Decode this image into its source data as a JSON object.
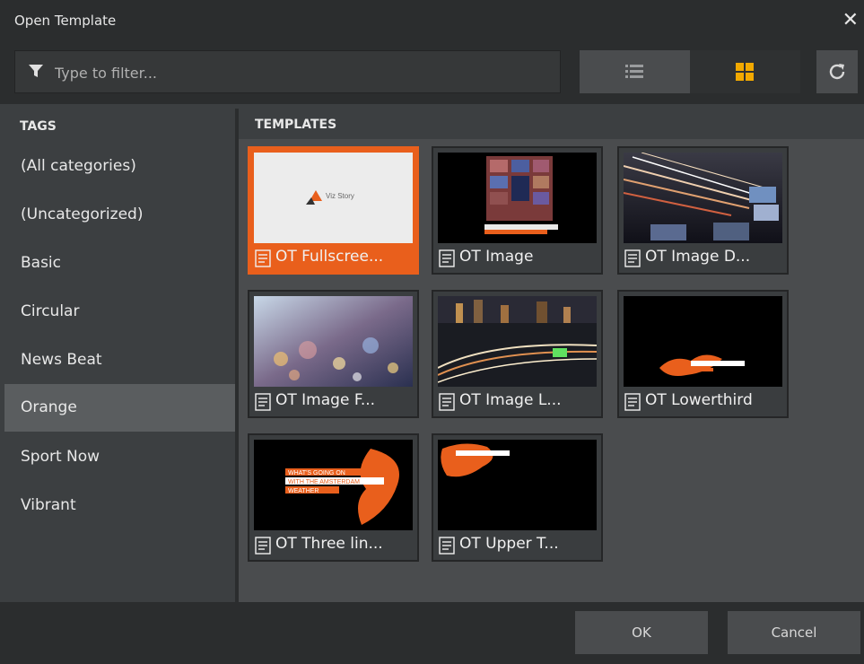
{
  "dialog": {
    "title": "Open Template",
    "close_icon": "close-icon"
  },
  "filter": {
    "placeholder": "Type to filter...",
    "icon": "filter-icon"
  },
  "view": {
    "list_icon": "list-view-icon",
    "grid_icon": "grid-view-icon",
    "selected": "grid",
    "accent_color": "#f2a900"
  },
  "refresh": {
    "icon": "refresh-icon"
  },
  "tags": {
    "header": "TAGS",
    "items": [
      {
        "label": "(All categories)"
      },
      {
        "label": "(Uncategorized)"
      },
      {
        "label": "Basic"
      },
      {
        "label": "Circular"
      },
      {
        "label": "News Beat"
      },
      {
        "label": "Orange",
        "selected": true
      },
      {
        "label": "Sport Now"
      },
      {
        "label": "Vibrant"
      }
    ]
  },
  "templates": {
    "header": "TEMPLATES",
    "items": [
      {
        "label": "OT Fullscree...",
        "selected": true,
        "thumb_text": "Viz Story"
      },
      {
        "label": "OT Image"
      },
      {
        "label": "OT Image D..."
      },
      {
        "label": "OT Image F..."
      },
      {
        "label": "OT Image L..."
      },
      {
        "label": "OT Lowerthird"
      },
      {
        "label": "OT Three lin...",
        "thumb_lines": [
          "WHAT'S GOING ON",
          "WITH THE AMSTERDAM",
          "WEATHER"
        ]
      },
      {
        "label": "OT Upper T..."
      }
    ],
    "item_icon": "template-icon"
  },
  "footer": {
    "ok_label": "OK",
    "cancel_label": "Cancel"
  },
  "colors": {
    "accent": "#e95f1c",
    "panel": "#3c3f41",
    "bar": "#2b2d2e"
  }
}
